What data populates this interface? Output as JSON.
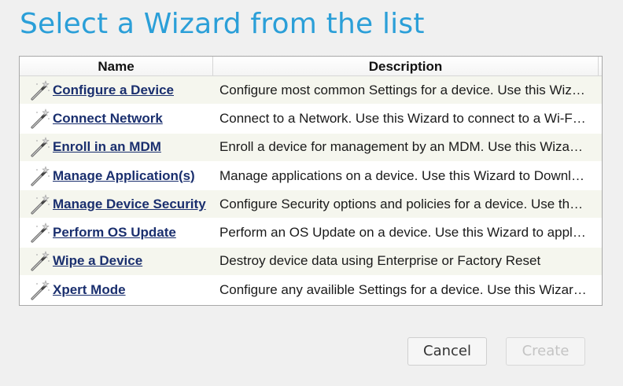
{
  "dialog": {
    "title": "Select a Wizard from the list"
  },
  "table": {
    "headers": {
      "name": "Name",
      "description": "Description"
    },
    "rows": [
      {
        "name": "Configure a Device",
        "description": "Configure most common Settings for a device. Use this Wiz…",
        "icon": "wand-icon"
      },
      {
        "name": "Connect Network",
        "description": "Connect to a Network. Use this Wizard to connect to a Wi-F…",
        "icon": "wand-icon"
      },
      {
        "name": "Enroll in an MDM",
        "description": "Enroll a device for management by an MDM.  Use this Wiza…",
        "icon": "wand-icon"
      },
      {
        "name": "Manage Application(s)",
        "description": "Manage applications on a device.  Use this Wizard to Downl…",
        "icon": "wand-icon"
      },
      {
        "name": "Manage Device Security",
        "description": "Configure Security options and policies for a device.  Use th…",
        "icon": "wand-icon"
      },
      {
        "name": "Perform OS Update",
        "description": "Perform an OS Update on a device.  Use this Wizard to appl…",
        "icon": "wand-icon"
      },
      {
        "name": "Wipe a Device",
        "description": "Destroy device data using Enterprise or Factory Reset",
        "icon": "wand-icon"
      },
      {
        "name": "Xpert Mode",
        "description": "Configure any availible Settings for a device. Use this Wizar…",
        "icon": "wand-icon"
      }
    ]
  },
  "buttons": {
    "cancel": "Cancel",
    "create": "Create"
  },
  "colors": {
    "title": "#2b9fd8",
    "link": "#1a2f6e",
    "alt_row": "#f5f6ee"
  }
}
